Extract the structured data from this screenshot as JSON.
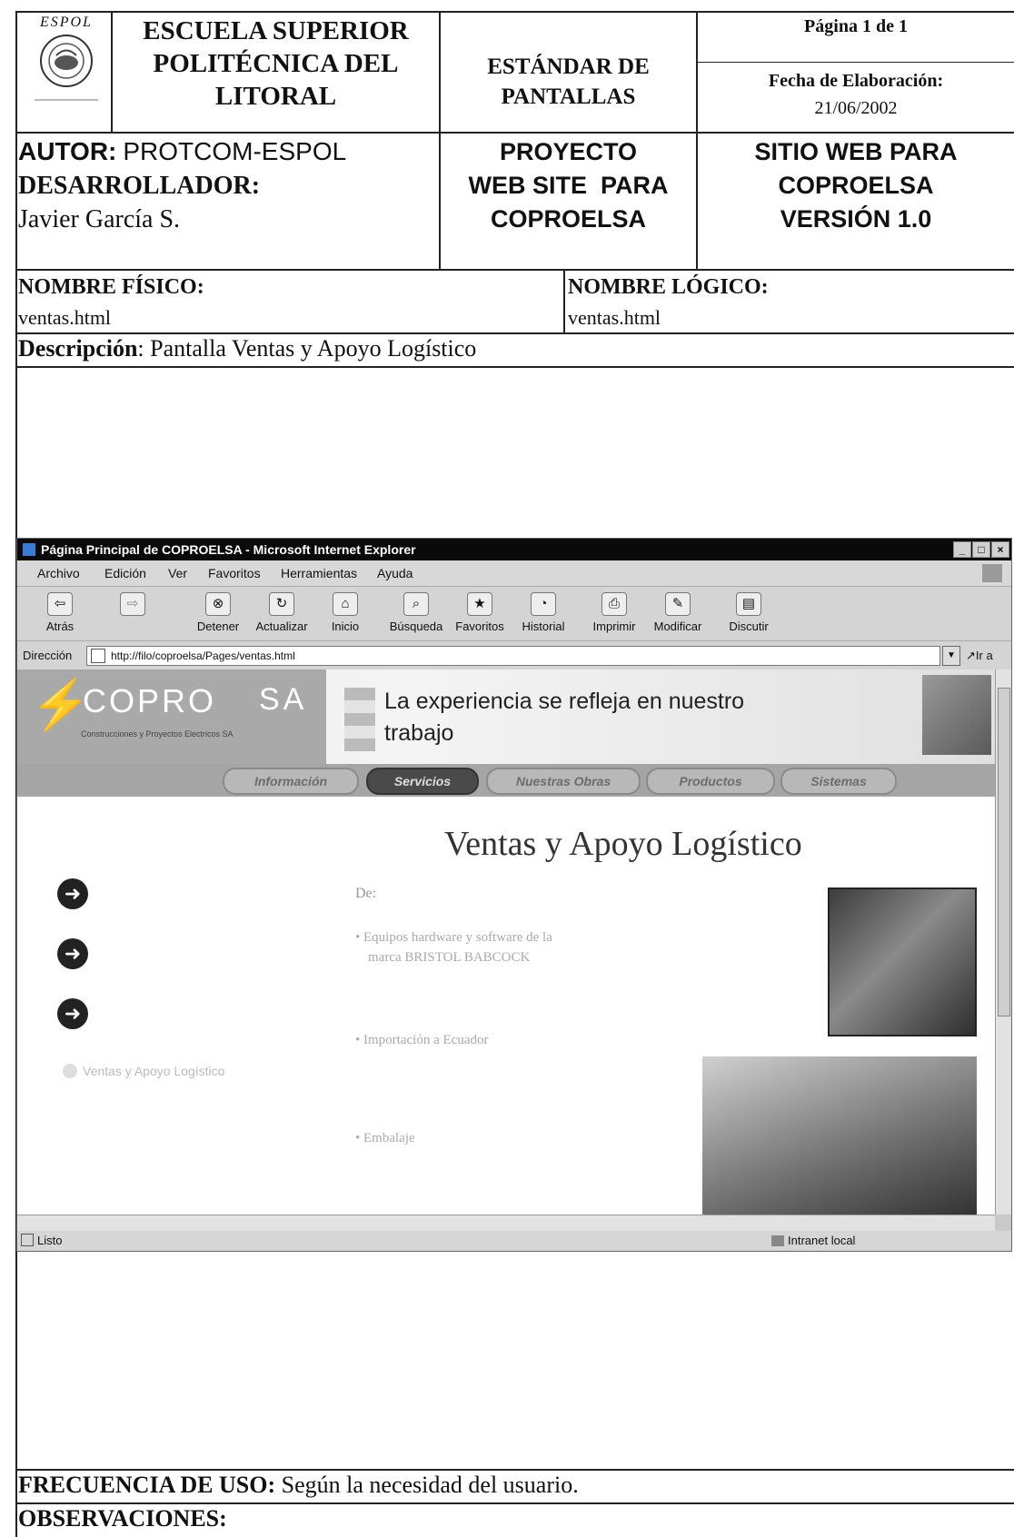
{
  "header": {
    "institution": [
      "ESCUELA SUPERIOR",
      "POLITÉCNICA DEL",
      "LITORAL"
    ],
    "logo_text": "ESPOL",
    "doc_type": [
      "ESTÁNDAR DE",
      "PANTALLAS"
    ],
    "page": "Página 1 de 1",
    "date_label": "Fecha de Elaboración:",
    "date_value": "21/06/2002"
  },
  "authors": {
    "autor_label": "AUTOR:",
    "autor_value": "PROTCOM-ESPOL",
    "desarrollador_label": "DESARROLLADOR:",
    "desarrollador_value": "Javier García S.",
    "proyecto": [
      "PROYECTO",
      "WEB SITE  PARA",
      "COPROELSA"
    ],
    "sitio": [
      "SITIO WEB PARA",
      "COPROELSA",
      "VERSIÓN 1.0"
    ]
  },
  "names": {
    "fisico_label": "NOMBRE FÍSICO:",
    "fisico_value": "ventas.html",
    "logico_label": "NOMBRE LÓGICO:",
    "logico_value": "ventas.html"
  },
  "description": {
    "label": "Descripción",
    "value": ": Pantalla Ventas y Apoyo Logístico"
  },
  "browser": {
    "title": "Página Principal de COPROELSA - Microsoft Internet Explorer",
    "menu": [
      "Archivo",
      "Edición",
      "Ver",
      "Favoritos",
      "Herramientas",
      "Ayuda"
    ],
    "toolbar": [
      "Atrás",
      "Detener",
      "Actualizar",
      "Inicio",
      "Búsqueda",
      "Favoritos",
      "Historial",
      "Imprimir",
      "Modificar",
      "Discutir"
    ],
    "address_label": "Dirección",
    "address_url": "http://filo/coproelsa/Pages/ventas.html",
    "go_label": "Ir a",
    "status_left": "Listo",
    "status_right": "Intranet local"
  },
  "site": {
    "logo_left": "COPRO",
    "logo_right": "SA",
    "logo_sub": "Construcciones y Proyectos Electricos SA",
    "slogan_line1": "La experiencia se refleja en nuestro",
    "slogan_line2": "trabajo",
    "tabs": [
      "Información",
      "Servicios",
      "Nuestras Obras",
      "Productos",
      "Sistemas"
    ],
    "page_title": "Ventas y Apoyo Logístico",
    "de_label": "De:",
    "bullet1_line1": "Equipos hardware y software de la",
    "bullet1_line2": "marca BRISTOL BABCOCK",
    "bullet2": "Importación a Ecuador",
    "bullet3": "Embalaje",
    "side_link": "Ventas y Apoyo Logístico"
  },
  "footer": {
    "frecuencia_label": "FRECUENCIA DE USO:",
    "frecuencia_value": "Según la necesidad del usuario.",
    "observaciones_label": "OBSERVACIONES:"
  }
}
